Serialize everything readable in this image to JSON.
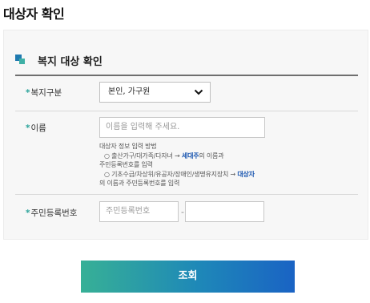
{
  "page": {
    "title": "대상자 확인"
  },
  "section": {
    "title": "복지 대상 확인"
  },
  "form": {
    "welfare_type": {
      "label": "복지구분",
      "selected": "본인, 가구원"
    },
    "name": {
      "label": "이름",
      "placeholder": "이름을 입력해 주세요.",
      "help": {
        "heading": "대상자 정보 입력 방법",
        "item1_prefix": "○ 출산가구/대가족/다자녀 → ",
        "item1_highlight": "세대주",
        "item1_suffix": "의 이름과",
        "item1_line2": "주민등록번호를 입력",
        "item2_prefix": "○ 기초수급/차상위/유공자/장애인/생명유지장치 → ",
        "item2_highlight": "대상자",
        "item2_line2": "의 이름과 주민등록번호를 입력"
      }
    },
    "rrn": {
      "label": "주민등록번호",
      "placeholder_front": "주민등록번호",
      "separator": "-",
      "placeholder_back": ""
    }
  },
  "actions": {
    "submit_label": "조회"
  },
  "colors": {
    "required_star": "#2aa39a",
    "highlight": "#1a56b0",
    "button_start": "#37b096",
    "button_end": "#1a63c4"
  }
}
